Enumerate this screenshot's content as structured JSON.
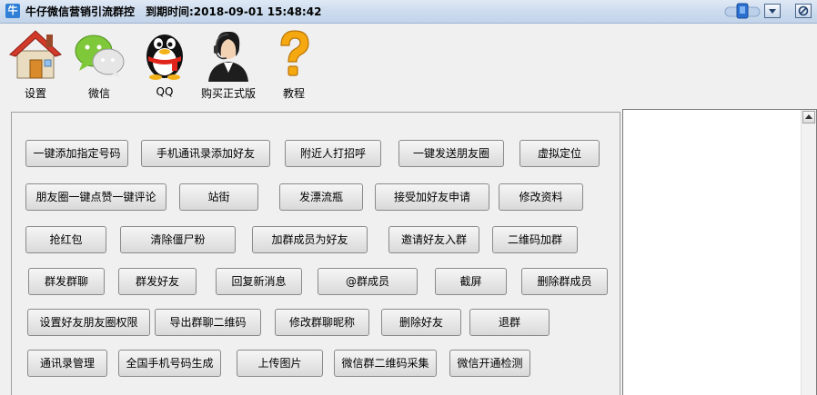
{
  "window": {
    "app_icon_text": "牛",
    "title": "牛仔微信营销引流群控",
    "expire": "到期时间:2018-09-01 15:48:42",
    "buttons": [
      "tray-icon",
      "minimize-icon",
      "close-icon"
    ]
  },
  "toolbar": {
    "items": [
      {
        "label": "设置",
        "icon": "house-icon"
      },
      {
        "label": "微信",
        "icon": "wechat-icon"
      },
      {
        "label": "QQ",
        "icon": "qq-penguin-icon"
      },
      {
        "label": "购买正式版",
        "icon": "customer-service-icon"
      },
      {
        "label": "教程",
        "icon": "question-mark-icon"
      }
    ]
  },
  "functions": {
    "rows": [
      [
        "一键添加指定号码",
        "手机通讯录添加好友",
        "附近人打招呼",
        "一键发送朋友圈",
        "虚拟定位"
      ],
      [
        "朋友圈一键点赞一键评论",
        "站街",
        "发漂流瓶",
        "接受加好友申请",
        "修改资料"
      ],
      [
        "抢红包",
        "清除僵尸粉",
        "加群成员为好友",
        "邀请好友入群",
        "二维码加群"
      ],
      [
        "群发群聊",
        "群发好友",
        "回复新消息",
        "@群成员",
        "截屏",
        "删除群成员"
      ],
      [
        "设置好友朋友圈权限",
        "导出群聊二维码",
        "修改群聊昵称",
        "删除好友",
        "退群"
      ],
      [
        "通讯录管理",
        "全国手机号码生成",
        "上传图片",
        "微信群二维码采集",
        "微信开通检测"
      ]
    ]
  },
  "log": {
    "content": ""
  },
  "colors": {
    "titlebar": "#cddcee",
    "background": "#f0f0f0",
    "accent": "#2f7fd6"
  }
}
